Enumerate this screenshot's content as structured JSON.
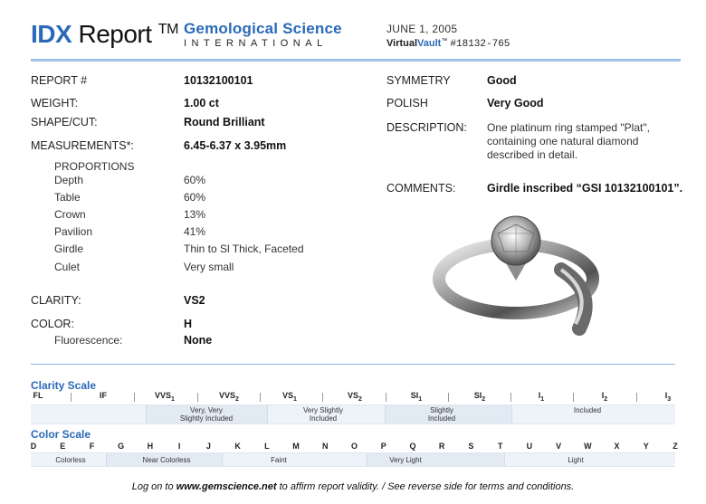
{
  "header": {
    "idx": "IDX",
    "report_word": "Report",
    "tm": "TM",
    "lab_name": "Gemological Science",
    "lab_sub": "INTERNATIONAL",
    "date": "JUNE 1, 2005",
    "vault_a": "Virtual",
    "vault_b": "Vault",
    "vault_tm": "™",
    "vault_number": "#18132-765"
  },
  "left": {
    "report_label": "REPORT #",
    "report_value": "10132100101",
    "weight_label": "WEIGHT:",
    "weight_value": "1.00 ct",
    "shape_label": "SHAPE/CUT:",
    "shape_value": "Round Brilliant",
    "meas_label": "MEASUREMENTS*:",
    "meas_value": "6.45-6.37 x 3.95mm",
    "proportions_label": "PROPORTIONS",
    "proportions": [
      {
        "label": "Depth",
        "value": "60%"
      },
      {
        "label": "Table",
        "value": "60%"
      },
      {
        "label": "Crown",
        "value": "13%"
      },
      {
        "label": "Pavilion",
        "value": "41%"
      },
      {
        "label": "Girdle",
        "value": "Thin to Sl Thick, Faceted"
      },
      {
        "label": "Culet",
        "value": "Very small"
      }
    ],
    "clarity_label": "CLARITY:",
    "clarity_value": "VS2",
    "color_label": "COLOR:",
    "color_value": "H",
    "fluor_label": "Fluorescence:",
    "fluor_value": "None"
  },
  "right": {
    "symmetry_label": "SYMMETRY",
    "symmetry_value": "Good",
    "polish_label": "POLISH",
    "polish_value": "Very Good",
    "description_label": "DESCRIPTION:",
    "description_value": "One platinum ring stamped \"Plat\", containing one natural diamond described in detail.",
    "comments_label": "COMMENTS:",
    "comments_value": "Girdle inscribed “GSI 10132100101”."
  },
  "clarity_scale": {
    "title": "Clarity Scale",
    "grades": [
      {
        "main": "FL",
        "sub": ""
      },
      {
        "main": "IF",
        "sub": ""
      },
      {
        "main": "VVS",
        "sub": "1"
      },
      {
        "main": "VVS",
        "sub": "2"
      },
      {
        "main": "VS",
        "sub": "1"
      },
      {
        "main": "VS",
        "sub": "2"
      },
      {
        "main": "SI",
        "sub": "1"
      },
      {
        "main": "SI",
        "sub": "2"
      },
      {
        "main": "I",
        "sub": "1"
      },
      {
        "main": "I",
        "sub": "2"
      },
      {
        "main": "I",
        "sub": "3"
      }
    ],
    "bands": [
      {
        "line1": "Very, Very",
        "line2": "Slightly Included"
      },
      {
        "line1": "Very Slightly",
        "line2": "Included"
      },
      {
        "line1": "Slightly",
        "line2": "Included"
      },
      {
        "line1": "Included",
        "line2": ""
      }
    ]
  },
  "color_scale": {
    "title": "Color Scale",
    "grades": [
      "D",
      "E",
      "F",
      "G",
      "H",
      "I",
      "J",
      "K",
      "L",
      "M",
      "N",
      "O",
      "P",
      "Q",
      "R",
      "S",
      "T",
      "U",
      "V",
      "W",
      "X",
      "Y",
      "Z"
    ],
    "bands": [
      "Colorless",
      "Near Colorless",
      "Faint",
      "Very Light",
      "Light"
    ]
  },
  "footer": {
    "pre": "Log on to ",
    "site": "www.gemscience.net",
    "post": " to affirm report validity.  /  See reverse side for terms and conditions."
  }
}
